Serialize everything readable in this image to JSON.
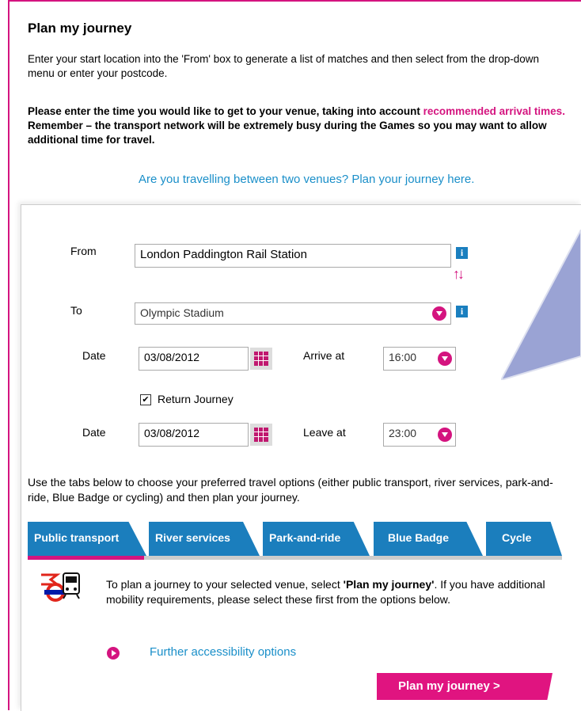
{
  "page": {
    "title": "Plan my journey",
    "intro": "Enter your start location into the 'From' box to generate a list of matches and then select from the drop-down menu or enter your postcode.",
    "notice_part1": "Please enter the time you would like to get to your venue, taking into account",
    "notice_link": "recommended arrival times.",
    "notice_part2": "Remember – the transport network will be extremely busy during the Games so you may want to allow additional time for travel.",
    "venues_link": "Are you travelling between two venues?  Plan your journey here."
  },
  "form": {
    "from_label": "From",
    "from_value": "London Paddington Rail Station",
    "to_label": "To",
    "to_value": "Olympic Stadium",
    "date_label": "Date",
    "date_value": "03/08/2012",
    "arrive_label": "Arrive at",
    "arrive_value": "16:00",
    "return_label": "Return Journey",
    "return_checked": "✔",
    "return_date_label": "Date",
    "return_date_value": "03/08/2012",
    "leave_label": "Leave at",
    "leave_value": "23:00",
    "info_glyph": "i",
    "swap_glyph": "↑↓"
  },
  "tabs": {
    "intro": "Use the tabs below to choose your preferred travel options (either public transport, river services, park-and-ride, Blue Badge or cycling) and then plan your journey.",
    "items": [
      {
        "label": "Public transport"
      },
      {
        "label": "River services"
      },
      {
        "label": "Park-and-ride"
      },
      {
        "label": "Blue Badge"
      },
      {
        "label": "Cycle"
      }
    ],
    "active": "Public transport"
  },
  "panel": {
    "text_part1": "To plan a journey to your selected venue, select ",
    "text_bold": "'Plan my journey'",
    "text_part2": ". If you have additional mobility requirements, please select these first from the options below.",
    "accessibility_link": "Further accessibility options",
    "plan_button": "Plan my journey >"
  },
  "colors": {
    "accent": "#d4147f",
    "link": "#1a8fc9",
    "tab": "#1b7ebd"
  }
}
